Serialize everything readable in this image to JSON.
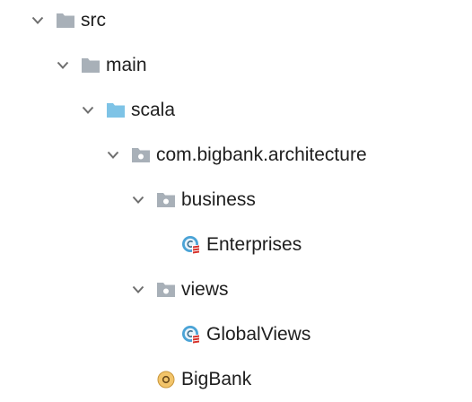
{
  "tree": {
    "nodes": [
      {
        "label": "src",
        "kind": "folder",
        "expanded": true
      },
      {
        "label": "main",
        "kind": "folder",
        "expanded": true
      },
      {
        "label": "scala",
        "kind": "source-folder",
        "expanded": true
      },
      {
        "label": "com.bigbank.architecture",
        "kind": "package",
        "expanded": true
      },
      {
        "label": "business",
        "kind": "package",
        "expanded": true
      },
      {
        "label": "Enterprises",
        "kind": "scala-class"
      },
      {
        "label": "views",
        "kind": "package",
        "expanded": true
      },
      {
        "label": "GlobalViews",
        "kind": "scala-class"
      },
      {
        "label": "BigBank",
        "kind": "scala-object"
      }
    ]
  },
  "colors": {
    "folder": "#a8b0b8",
    "source_folder": "#7ec3e6",
    "chevron": "#6e6e6e",
    "class_ring": "#4aa3d6",
    "scala_red": "#d6312a",
    "object_fill": "#f2c46a",
    "object_ring": "#c9963a"
  }
}
